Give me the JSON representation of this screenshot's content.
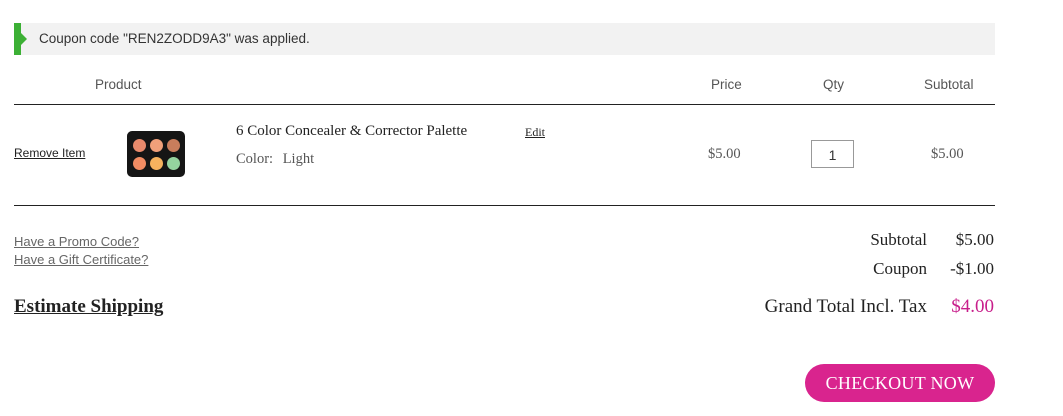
{
  "notice": {
    "message": "Coupon code \"REN2ZODD9A3\" was applied."
  },
  "table": {
    "headers": {
      "product": "Product",
      "price": "Price",
      "qty": "Qty",
      "subtotal": "Subtotal"
    }
  },
  "item": {
    "remove_label": "Remove Item",
    "name": "6 Color Concealer & Corrector Palette",
    "edit_label": "Edit",
    "color_label": "Color:",
    "color_value": "Light",
    "price": "$5.00",
    "qty": "1",
    "subtotal": "$5.00",
    "swatch_colors": [
      "#e98a6c",
      "#f0a07a",
      "#c97d5c",
      "#f28c63",
      "#f6b25e",
      "#95d39f"
    ]
  },
  "links": {
    "promo": "Have a Promo Code?",
    "gift": "Have a Gift Certificate?",
    "estimate": "Estimate Shipping"
  },
  "totals": {
    "subtotal_label": "Subtotal",
    "subtotal_value": "$5.00",
    "coupon_label": "Coupon",
    "coupon_value": "-$1.00",
    "grand_label": "Grand Total Incl. Tax",
    "grand_value": "$4.00"
  },
  "checkout_label": "CHECKOUT NOW",
  "colors": {
    "accent": "#d9248e",
    "grand_total": "#c81e8b",
    "success": "#3cb035"
  }
}
